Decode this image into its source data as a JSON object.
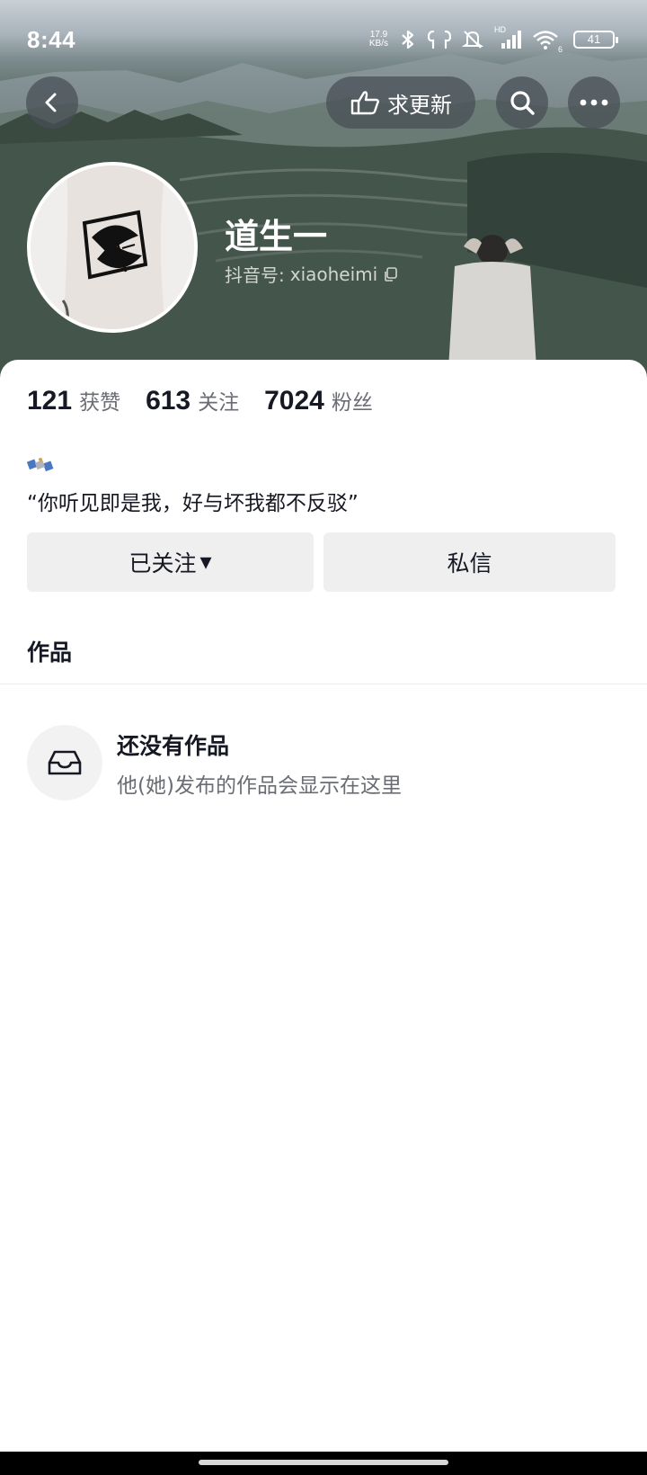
{
  "status_bar": {
    "time": "8:44",
    "net_speed_value": "17.9",
    "net_speed_unit": "KB/s",
    "signal_badge": "HD",
    "wifi_badge": "6",
    "battery": "41",
    "icons": [
      "bluetooth-icon",
      "earbuds-icon",
      "mute-bell-icon",
      "cellular-signal-icon",
      "wifi-icon",
      "battery-icon"
    ]
  },
  "nav": {
    "request_update_label": "求更新",
    "icons": [
      "back-arrow-icon",
      "hand-pointer-icon",
      "search-icon",
      "more-dots-icon"
    ]
  },
  "profile": {
    "name": "道生一",
    "id_prefix": "抖音号: ",
    "id_value": "xiaoheimi",
    "avatar_desc_icon": "avatar-image"
  },
  "stats": [
    {
      "value": "121",
      "label": "获赞"
    },
    {
      "value": "613",
      "label": "关注"
    },
    {
      "value": "7024",
      "label": "粉丝"
    }
  ],
  "bio": {
    "emoji_icon": "satellite-emoji-icon",
    "text": "“你听见即是我，好与坏我都不反驳”"
  },
  "actions": {
    "follow_label": "已关注",
    "follow_caret": "▾",
    "message_label": "私信"
  },
  "works": {
    "tab_label": "作品",
    "empty_title": "还没有作品",
    "empty_subtitle": "他(她)发布的作品会显示在这里",
    "empty_icon": "inbox-tray-icon"
  },
  "colors": {
    "text_primary": "#161823",
    "text_secondary": "#6b6d74",
    "button_bg": "#efefef",
    "nav_button_bg": "#464e54"
  }
}
